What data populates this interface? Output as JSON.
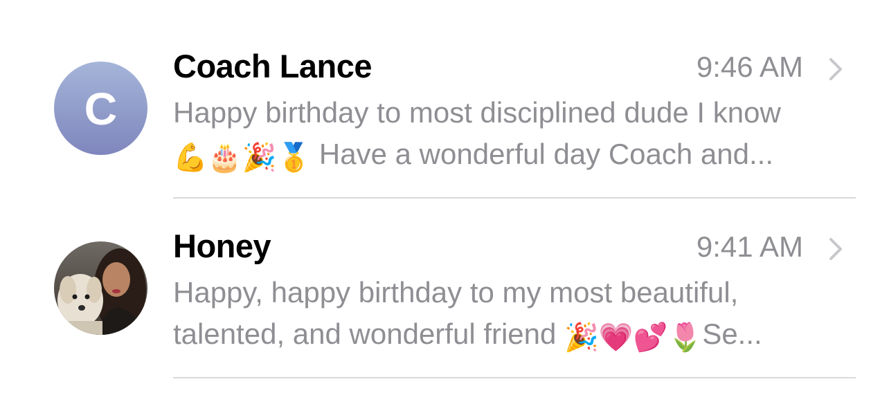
{
  "conversations": [
    {
      "name": "Coach Lance",
      "time": "9:46 AM",
      "avatar_initial": "C",
      "preview_line1": "Happy birthday to most disciplined dude I know",
      "preview_line2_emojis": [
        "💪",
        "🎂",
        "🎉",
        "🥇"
      ],
      "preview_line2_text": "Have a wonderful day Coach and..."
    },
    {
      "name": "Honey",
      "time": "9:41 AM",
      "avatar": "photo-avatar",
      "preview_line1": "Happy, happy birthday to my most beautiful,",
      "preview_line2_text": "talented, and wonderful friend",
      "preview_line2_emojis": [
        "🎉",
        "💗",
        "💕",
        "🌷"
      ],
      "preview_line2_tail": "Se..."
    }
  ],
  "icons": {
    "chevron": "chevron-right-icon"
  },
  "colors": {
    "name": "#000000",
    "secondary_text": "#8e8e93",
    "divider": "#d9d9d9",
    "avatar_gradient_top": "#a5b5d9",
    "avatar_gradient_bottom": "#7f86bd"
  }
}
